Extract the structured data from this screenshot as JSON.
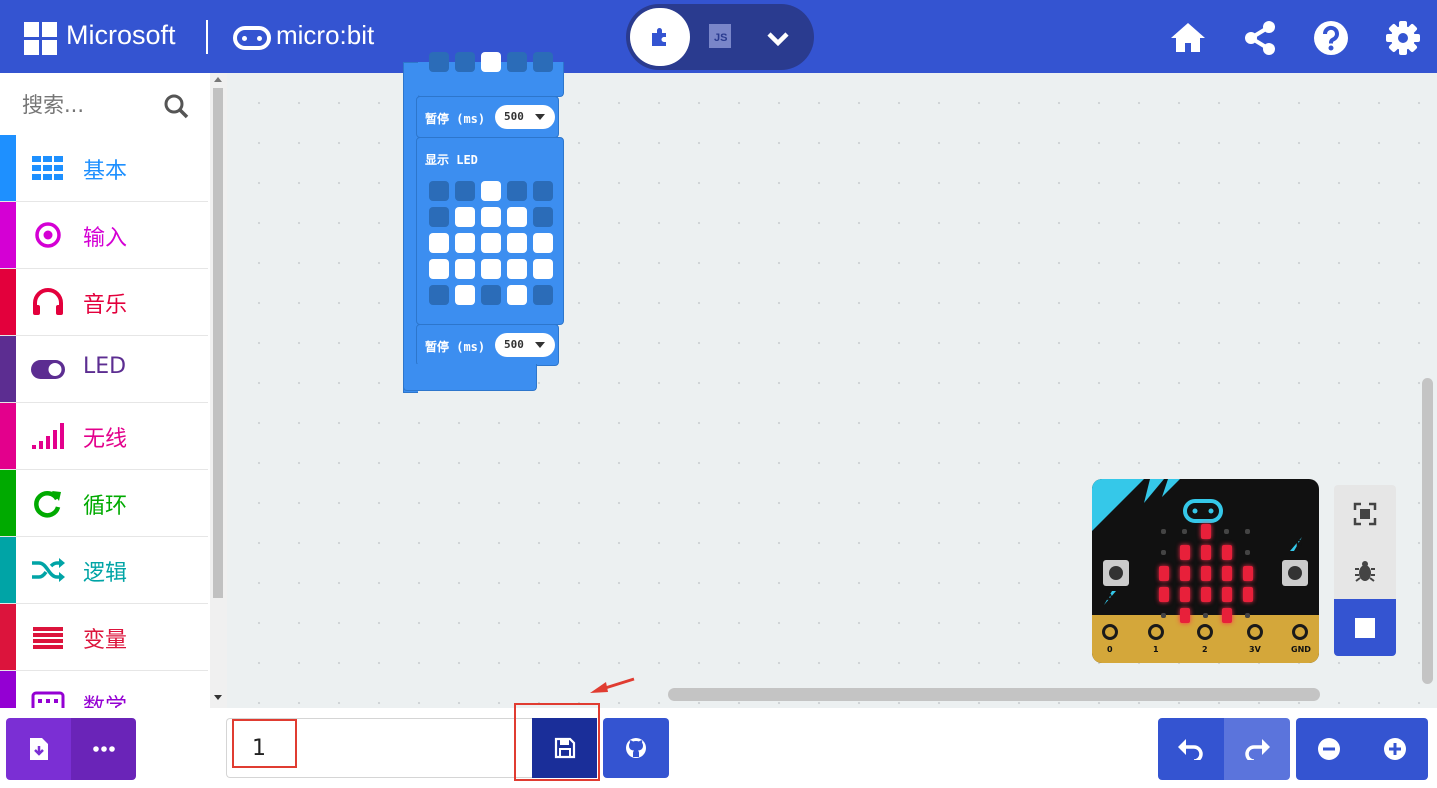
{
  "header": {
    "microsoft_label": "Microsoft",
    "product_label": "micro:bit",
    "editor_toggle": {
      "blocks_icon": "puzzle-icon",
      "js_label": "JS",
      "more_icon": "chevron-down-icon"
    },
    "buttons": [
      {
        "icon": "home-icon"
      },
      {
        "icon": "share-icon"
      },
      {
        "icon": "help-icon"
      },
      {
        "icon": "gear-icon"
      }
    ]
  },
  "sidebar": {
    "search_placeholder": "搜索...",
    "categories": [
      {
        "label": "基本",
        "color": "#1e90ff",
        "icon": "grid-icon"
      },
      {
        "label": "输入",
        "color": "#d400d4",
        "icon": "target-icon"
      },
      {
        "label": "音乐",
        "color": "#e3008c",
        "icon": "headphones-icon"
      },
      {
        "label": "LED",
        "color": "#5c2d91",
        "icon": "toggle-icon"
      },
      {
        "label": "无线",
        "color": "#e3008c",
        "icon": "signal-bars-icon"
      },
      {
        "label": "循环",
        "color": "#00aa00",
        "icon": "loop-icon"
      },
      {
        "label": "逻辑",
        "color": "#00a4a6",
        "icon": "shuffle-icon"
      },
      {
        "label": "变量",
        "color": "#dc143c",
        "icon": "list-icon"
      },
      {
        "label": "数学",
        "color": "#9400d3",
        "icon": "calculator-icon"
      }
    ]
  },
  "workspace": {
    "blocks": {
      "pause1": {
        "label": "暂停 (ms)",
        "value": "500"
      },
      "show_leds": {
        "label": "显示 LED"
      },
      "pause2": {
        "label": "暂停 (ms)",
        "value": "500"
      }
    },
    "led_grid": [
      [
        0,
        0,
        1,
        0,
        0
      ],
      [
        0,
        1,
        1,
        1,
        0
      ],
      [
        1,
        1,
        1,
        1,
        1
      ],
      [
        1,
        1,
        1,
        1,
        1
      ],
      [
        0,
        1,
        0,
        1,
        0
      ]
    ]
  },
  "simulator": {
    "button_a": "A",
    "button_b": "B",
    "pins": [
      "0",
      "1",
      "2",
      "3V",
      "GND"
    ],
    "tools": {
      "fullscreen_icon": "fullscreen-icon",
      "debug_icon": "bug-icon",
      "stop_icon": "stop-icon"
    }
  },
  "footer": {
    "download_icon": "download-icon",
    "more_icon": "ellipsis-icon",
    "project_name": "1",
    "save_icon": "save-icon",
    "github_icon": "github-icon",
    "undo_icon": "undo-icon",
    "redo_icon": "redo-icon",
    "zoom_out_icon": "zoom-out-icon",
    "zoom_in_icon": "zoom-in-icon"
  },
  "colors": {
    "header": "#3454d1",
    "workspace": "#ecf0f1",
    "block": "#3c8ef0",
    "highlight": "#e03c31"
  }
}
